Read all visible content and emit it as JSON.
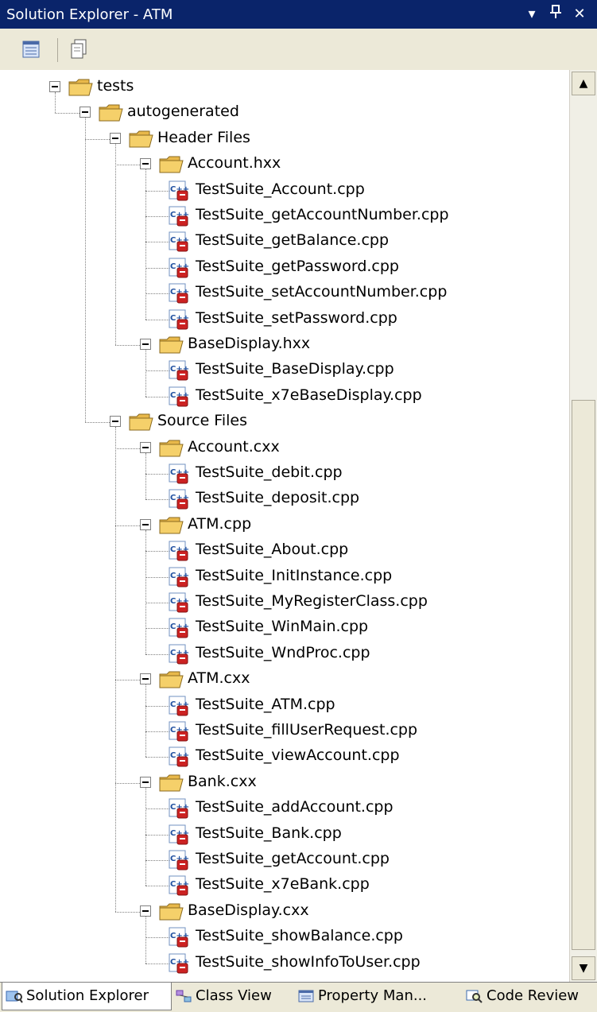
{
  "window": {
    "title": "Solution Explorer - ATM",
    "dropdown_glyph": "▾",
    "pin_glyph": "ᵖ",
    "close_glyph": "✕"
  },
  "toolbar": {
    "buttons": [
      {
        "name": "properties-icon"
      },
      {
        "name": "show-all-files-icon"
      }
    ]
  },
  "tree": {
    "rows": [
      {
        "label": "tests",
        "depth": 0,
        "kind": "folder"
      },
      {
        "label": "autogenerated",
        "depth": 1,
        "kind": "folder"
      },
      {
        "label": "Header Files",
        "depth": 2,
        "kind": "folder"
      },
      {
        "label": "Account.hxx",
        "depth": 3,
        "kind": "folder"
      },
      {
        "label": "TestSuite_Account.cpp",
        "depth": 4,
        "kind": "file"
      },
      {
        "label": "TestSuite_getAccountNumber.cpp",
        "depth": 4,
        "kind": "file"
      },
      {
        "label": "TestSuite_getBalance.cpp",
        "depth": 4,
        "kind": "file"
      },
      {
        "label": "TestSuite_getPassword.cpp",
        "depth": 4,
        "kind": "file"
      },
      {
        "label": "TestSuite_setAccountNumber.cpp",
        "depth": 4,
        "kind": "file"
      },
      {
        "label": "TestSuite_setPassword.cpp",
        "depth": 4,
        "kind": "file"
      },
      {
        "label": "BaseDisplay.hxx",
        "depth": 3,
        "kind": "folder"
      },
      {
        "label": "TestSuite_BaseDisplay.cpp",
        "depth": 4,
        "kind": "file"
      },
      {
        "label": "TestSuite_x7eBaseDisplay.cpp",
        "depth": 4,
        "kind": "file"
      },
      {
        "label": "Source Files",
        "depth": 2,
        "kind": "folder"
      },
      {
        "label": "Account.cxx",
        "depth": 3,
        "kind": "folder"
      },
      {
        "label": "TestSuite_debit.cpp",
        "depth": 4,
        "kind": "file"
      },
      {
        "label": "TestSuite_deposit.cpp",
        "depth": 4,
        "kind": "file"
      },
      {
        "label": "ATM.cpp",
        "depth": 3,
        "kind": "folder"
      },
      {
        "label": "TestSuite_About.cpp",
        "depth": 4,
        "kind": "file"
      },
      {
        "label": "TestSuite_InitInstance.cpp",
        "depth": 4,
        "kind": "file"
      },
      {
        "label": "TestSuite_MyRegisterClass.cpp",
        "depth": 4,
        "kind": "file"
      },
      {
        "label": "TestSuite_WinMain.cpp",
        "depth": 4,
        "kind": "file"
      },
      {
        "label": "TestSuite_WndProc.cpp",
        "depth": 4,
        "kind": "file"
      },
      {
        "label": "ATM.cxx",
        "depth": 3,
        "kind": "folder"
      },
      {
        "label": "TestSuite_ATM.cpp",
        "depth": 4,
        "kind": "file"
      },
      {
        "label": "TestSuite_fillUserRequest.cpp",
        "depth": 4,
        "kind": "file"
      },
      {
        "label": "TestSuite_viewAccount.cpp",
        "depth": 4,
        "kind": "file"
      },
      {
        "label": "Bank.cxx",
        "depth": 3,
        "kind": "folder"
      },
      {
        "label": "TestSuite_addAccount.cpp",
        "depth": 4,
        "kind": "file"
      },
      {
        "label": "TestSuite_Bank.cpp",
        "depth": 4,
        "kind": "file"
      },
      {
        "label": "TestSuite_getAccount.cpp",
        "depth": 4,
        "kind": "file"
      },
      {
        "label": "TestSuite_x7eBank.cpp",
        "depth": 4,
        "kind": "file"
      },
      {
        "label": "BaseDisplay.cxx",
        "depth": 3,
        "kind": "folder"
      },
      {
        "label": "TestSuite_showBalance.cpp",
        "depth": 4,
        "kind": "file"
      },
      {
        "label": "TestSuite_showInfoToUser.cpp",
        "depth": 4,
        "kind": "file"
      }
    ]
  },
  "scrollbar": {
    "up_glyph": "▲",
    "down_glyph": "▼"
  },
  "tabs": [
    {
      "label": "Solution Explorer",
      "icon": "solution-explorer-icon",
      "active": true
    },
    {
      "label": "Class View",
      "icon": "class-view-icon",
      "active": false
    },
    {
      "label": "Property Man...",
      "icon": "property-manager-icon",
      "active": false
    },
    {
      "label": "Code Review",
      "icon": "code-review-icon",
      "active": false
    }
  ],
  "colors": {
    "titlebar": "#0a246a",
    "folder": "#f5d06a",
    "cpp_badge": "#cc2222"
  }
}
